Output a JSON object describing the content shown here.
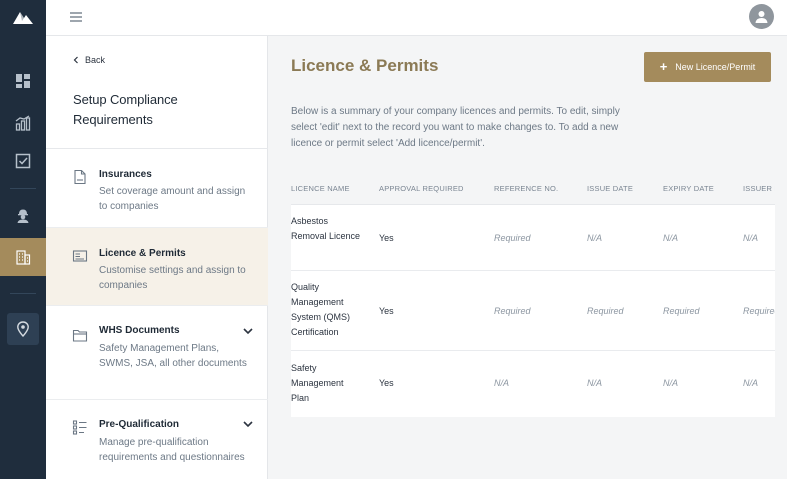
{
  "panel": {
    "back_label": "Back",
    "title": "Setup Compliance Requirements",
    "items": [
      {
        "title": "Insurances",
        "desc": "Set coverage amount and assign to companies"
      },
      {
        "title": "Licence & Permits",
        "desc": "Customise settings and assign to companies"
      },
      {
        "title": "WHS Documents",
        "desc": "Safety Management Plans, SWMS, JSA, all other documents"
      },
      {
        "title": "Pre-Qualification",
        "desc": "Manage pre-qualification requirements and questionnaires"
      }
    ]
  },
  "main": {
    "title": "Licence & Permits",
    "new_button_label": "New Licence/Permit",
    "summary": "Below is a summary of your company licences and permits. To edit, simply select 'edit' next to the record you want to make changes to. To add a new licence or permit select 'Add licence/permit'."
  },
  "table": {
    "headers": [
      "LICENCE NAME",
      "APPROVAL REQUIRED",
      "REFERENCE NO.",
      "ISSUE DATE",
      "EXPIRY DATE",
      "ISSUER NAME"
    ],
    "rows": [
      {
        "name": "Asbestos Removal Licence",
        "approval": "Yes",
        "reference": "Required",
        "issue": "N/A",
        "expiry": "N/A",
        "issuer": "N/A"
      },
      {
        "name": "Quality Management System (QMS) Certification",
        "approval": "Yes",
        "reference": "Required",
        "issue": "Required",
        "expiry": "Required",
        "issuer": "Required"
      },
      {
        "name": "Safety Management Plan",
        "approval": "Yes",
        "reference": "N/A",
        "issue": "N/A",
        "expiry": "N/A",
        "issuer": "N/A"
      }
    ]
  },
  "icons": {
    "rail": [
      "logo-icon",
      "dashboard-icon",
      "chart-icon",
      "checklist-icon",
      "worker-icon",
      "building-icon",
      "location-pin-icon"
    ],
    "topbar": [
      "menu-icon",
      "user-avatar-icon"
    ]
  },
  "colors": {
    "rail_bg": "#1f2d3d",
    "accent": "#a48b5c",
    "title_gold": "#8b7a55",
    "active_item_bg": "#f6f1e8"
  }
}
